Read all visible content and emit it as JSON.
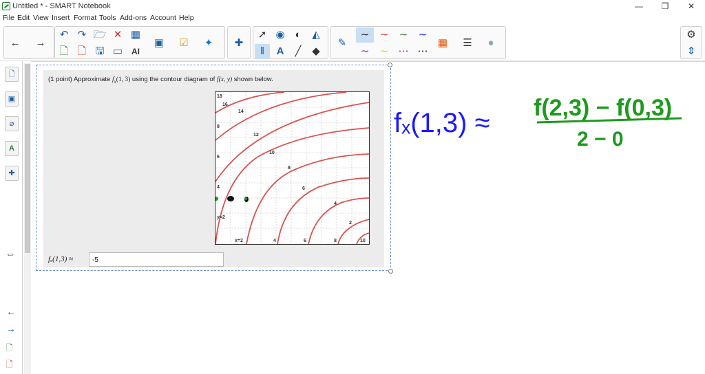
{
  "window": {
    "title": "Untitled * - SMART Notebook",
    "minimize": "—",
    "restore": "❐",
    "close": "✕"
  },
  "menu": [
    "File",
    "Edit",
    "View",
    "Insert",
    "Format",
    "Tools",
    "Add-ons",
    "Account",
    "Help"
  ],
  "problem": {
    "prefix": "(1 point) Approximate ",
    "fx_term": "f",
    "fx_sub": "x",
    "fx_args": "(1, 3)",
    "mid": " using the contour diagram of ",
    "fxy": "f(x, y)",
    "suffix": " shown below.",
    "answer_label": "fₓ(1,3) ≈",
    "answer_value": "-5"
  },
  "contour_labels": {
    "top_left": [
      "18",
      "16",
      "14",
      "12",
      "10",
      "8",
      "6",
      "4",
      "2"
    ],
    "left": [
      "8",
      "6",
      "4",
      "y=2"
    ],
    "bottom": [
      "x=2",
      "4",
      "6",
      "8",
      "10"
    ]
  },
  "handwriting": {
    "lhs": "fₓ(1,3) ≈",
    "numerator": "f(2,3) − f(0,3)",
    "denominator": "2 − 0",
    "colors": {
      "lhs": "#1a1aff",
      "fraction": "#1e9a1e"
    }
  },
  "colors": {
    "contour": "#d9534f",
    "accent": "#1d5fa8",
    "selection": "#6a8bd0"
  }
}
